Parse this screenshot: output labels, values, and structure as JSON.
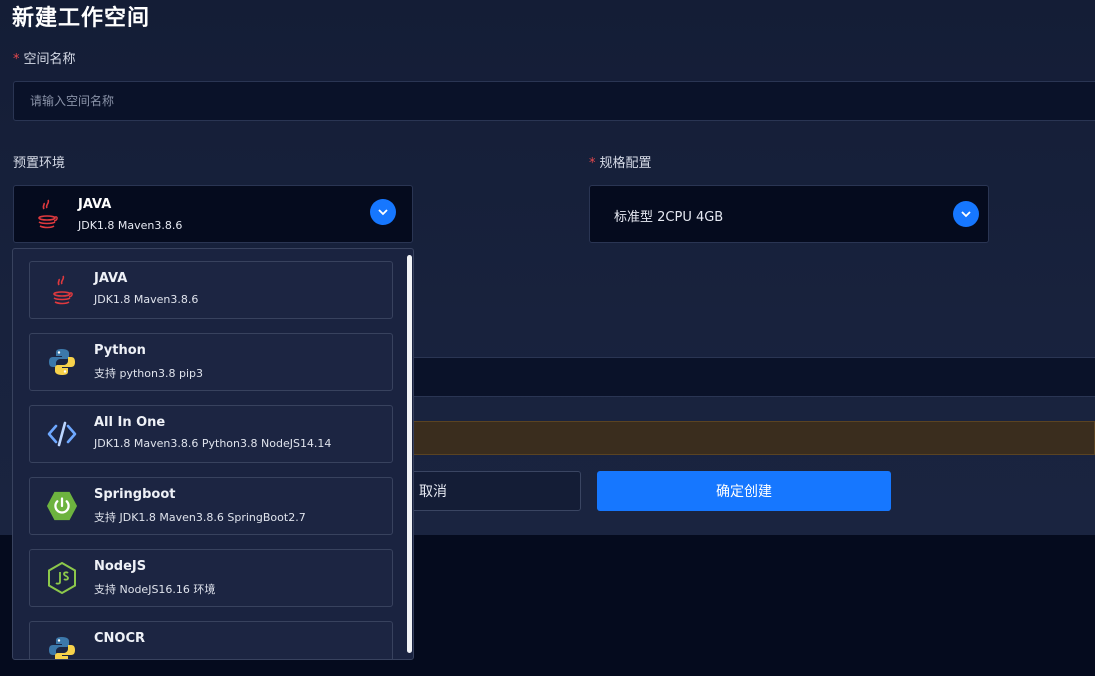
{
  "page": {
    "title": "新建工作空间"
  },
  "form": {
    "name_label": "空间名称",
    "name_placeholder": "请输入空间名称",
    "env_label": "预置环境",
    "spec_label": "规格配置",
    "required_mark": "*"
  },
  "env_select": {
    "selected_name": "JAVA",
    "selected_desc": "JDK1.8 Maven3.8.6",
    "icon": "java-icon"
  },
  "spec_select": {
    "selected": "标准型 2CPU 4GB"
  },
  "buttons": {
    "cancel": "取消",
    "confirm": "确定创建"
  },
  "dropdown": {
    "options": [
      {
        "name": "JAVA",
        "desc": "JDK1.8 Maven3.8.6",
        "icon": "java-icon"
      },
      {
        "name": "Python",
        "desc": "支持 python3.8 pip3",
        "icon": "python-icon"
      },
      {
        "name": "All In One",
        "desc": "JDK1.8 Maven3.8.6 Python3.8 NodeJS14.14",
        "icon": "code-icon"
      },
      {
        "name": "Springboot",
        "desc": "支持 JDK1.8 Maven3.8.6 SpringBoot2.7",
        "icon": "springboot-icon"
      },
      {
        "name": "NodeJS",
        "desc": "支持 NodeJS16.16 环境",
        "icon": "nodejs-icon"
      },
      {
        "name": "CNOCR",
        "desc": "",
        "icon": "python-icon"
      }
    ]
  },
  "colors": {
    "accent": "#1677ff",
    "required": "#e5484d",
    "panel": "#18223d"
  }
}
